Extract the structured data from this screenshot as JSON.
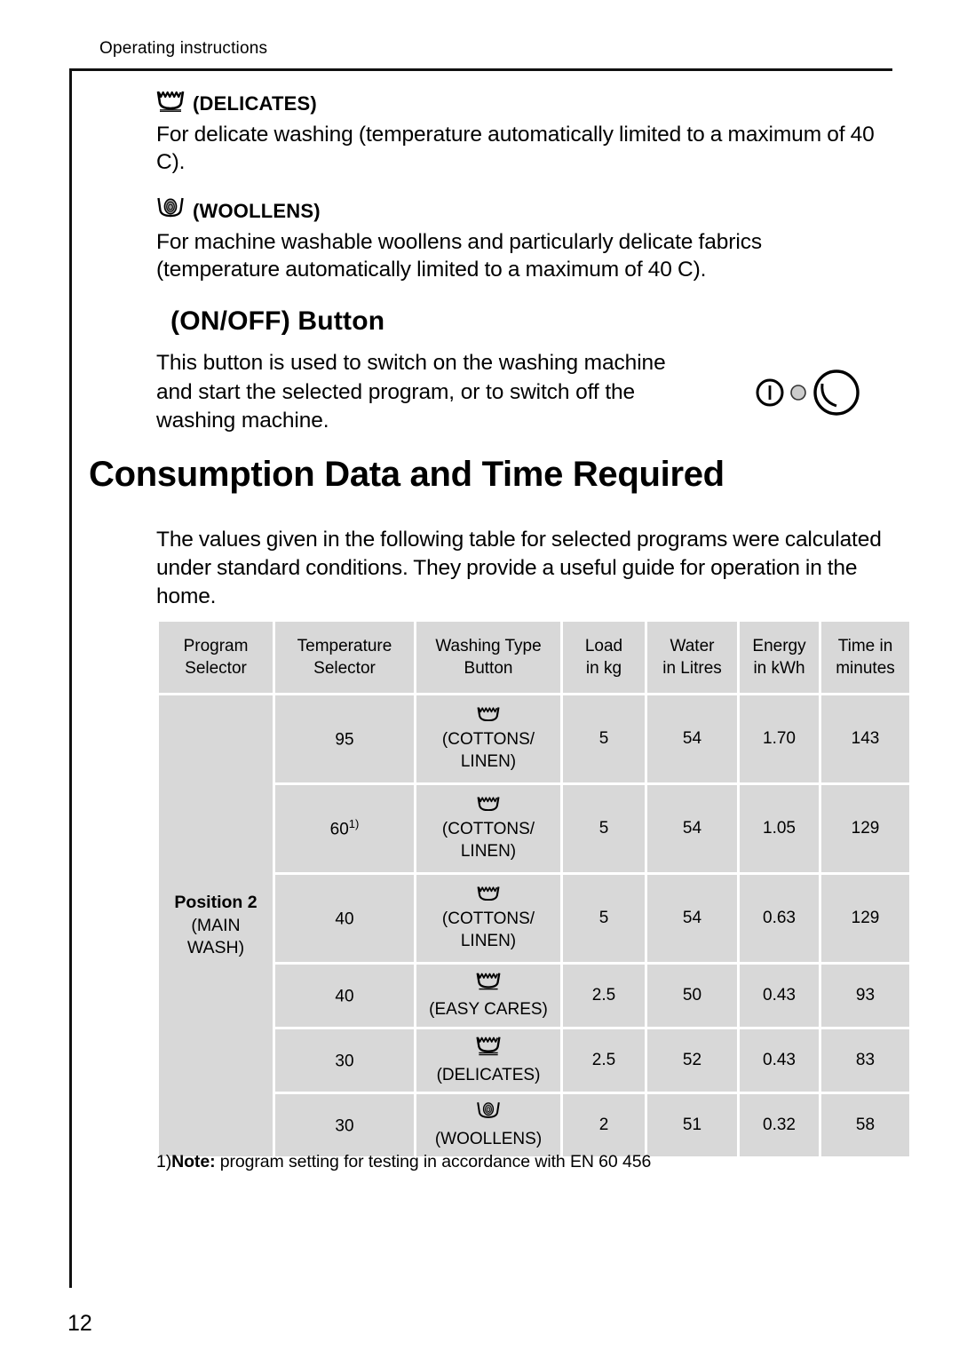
{
  "page": {
    "running_header": "Operating instructions",
    "page_number": "12"
  },
  "sections": {
    "delicates": {
      "icon": "wash-tub-delicates-icon",
      "heading": "(DELICATES)",
      "body": "For delicate washing (temperature automatically limited to a maximum of 40 C)."
    },
    "woollens": {
      "icon": "wash-tub-woollens-icon",
      "heading": "(WOOLLENS)",
      "body": "For machine washable woollens and particularly delicate fabrics (temperature automatically limited to a maximum of 40 C)."
    },
    "onoff": {
      "heading": "(ON/OFF) Button",
      "body": "This button is used to switch on the washing machine and start the selected program, or to switch off the washing machine.",
      "graphic": "onoff-button-illustration"
    }
  },
  "chapter": {
    "title": "Consumption Data and Time Required",
    "intro": "The values given in the following table for selected programs were calculated under standard conditions. They provide a useful guide for operation in the home."
  },
  "table": {
    "headers": [
      {
        "line1": "Program",
        "line2": "Selector"
      },
      {
        "line1": "Temperature",
        "line2": "Selector"
      },
      {
        "line1": "Washing Type",
        "line2": "Button"
      },
      {
        "line1": "Load",
        "line2": "in kg"
      },
      {
        "line1": "Water",
        "line2": "in Litres"
      },
      {
        "line1": "Energy",
        "line2": "in kWh"
      },
      {
        "line1": "Time in",
        "line2": "minutes"
      }
    ],
    "program_group": {
      "title": "Position 2",
      "sub_line1": "(MAIN",
      "sub_line2": "WASH)"
    },
    "rows": [
      {
        "temperature": "95",
        "temperature_note": "",
        "type_icon": "wash-tub-cottons-icon",
        "type_label": "(COTTONS/ LINEN)",
        "load": "5",
        "water": "54",
        "energy": "1.70",
        "time": "143"
      },
      {
        "temperature": "60",
        "temperature_note": "1)",
        "type_icon": "wash-tub-cottons-icon",
        "type_label": "(COTTONS/ LINEN)",
        "load": "5",
        "water": "54",
        "energy": "1.05",
        "time": "129"
      },
      {
        "temperature": "40",
        "temperature_note": "",
        "type_icon": "wash-tub-cottons-icon",
        "type_label": "(COTTONS/ LINEN)",
        "load": "5",
        "water": "54",
        "energy": "0.63",
        "time": "129"
      },
      {
        "temperature": "40",
        "temperature_note": "",
        "type_icon": "wash-tub-easycares-icon",
        "type_label": "(EASY CARES)",
        "load": "2.5",
        "water": "50",
        "energy": "0.43",
        "time": "93"
      },
      {
        "temperature": "30",
        "temperature_note": "",
        "type_icon": "wash-tub-delicates-icon",
        "type_label": "(DELICATES)",
        "load": "2.5",
        "water": "52",
        "energy": "0.43",
        "time": "83"
      },
      {
        "temperature": "30",
        "temperature_note": "",
        "type_icon": "wash-tub-woollens-icon",
        "type_label": "(WOOLLENS)",
        "load": "2",
        "water": "51",
        "energy": "0.32",
        "time": "58"
      }
    ]
  },
  "footnote": {
    "marker": "1)",
    "label": "Note:",
    "text": " program setting for testing in accordance with EN 60 456"
  },
  "colors": {
    "cell_background": "#d8d8d8",
    "rule": "#111111",
    "text": "#000000",
    "lamp_fill": "#cccccc"
  }
}
